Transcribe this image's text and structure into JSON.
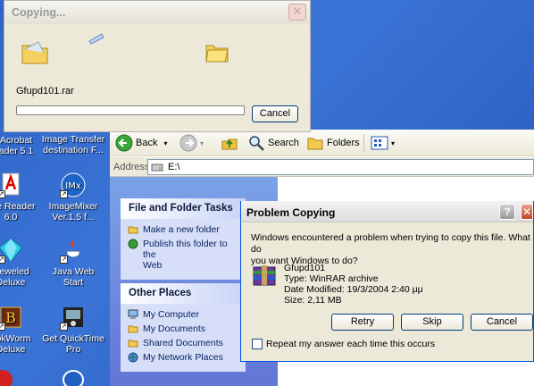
{
  "desktop": {
    "icons": [
      {
        "label_line1": "Acrobat",
        "label_line2": "ader 5.1"
      },
      {
        "label_line1": "Image Transfer",
        "label_line2": "destination F..."
      },
      {
        "label_line1": "obe Reader",
        "label_line2": "6.0"
      },
      {
        "label_line1": "ImageMixer",
        "label_line2": "Ver.1.5 f..."
      },
      {
        "label_line1": "ejeweled",
        "label_line2": "Deluxe"
      },
      {
        "label_line1": "Java Web",
        "label_line2": "Start"
      },
      {
        "label_line1": "ookWorm",
        "label_line2": "Deluxe"
      },
      {
        "label_line1": "Get QuickTime",
        "label_line2": "Pro"
      }
    ]
  },
  "copy_dialog": {
    "title": "Copying...",
    "filename": "Gfupd101.rar",
    "cancel_label": "Cancel",
    "progress": 0
  },
  "explorer": {
    "toolbar": {
      "back_label": "Back",
      "search_label": "Search",
      "folders_label": "Folders"
    },
    "address": {
      "label": "Address",
      "value": "E:\\"
    },
    "file_folder_tasks": {
      "title": "File and Folder Tasks",
      "items": [
        "Make a new folder",
        "Publish this folder to the",
        "Web"
      ]
    },
    "other_places": {
      "title": "Other Places",
      "items": [
        "My Computer",
        "My Documents",
        "Shared Documents",
        "My Network Places"
      ]
    }
  },
  "problem_dialog": {
    "title": "Problem Copying",
    "help_label": "?",
    "message_line1": "Windows encountered a problem when trying to copy this file.  What do",
    "message_line2": "you want Windows to do?",
    "file_name": "Gfupd101",
    "file_type": "Type: WinRAR archive",
    "file_date": "Date Modified: 19/3/2004 2:40 μμ",
    "file_size": "Size: 2,11 MB",
    "retry_label": "Retry",
    "skip_label": "Skip",
    "cancel_label": "Cancel",
    "repeat_label": "Repeat my answer each time this occurs",
    "repeat_checked": false
  },
  "colors": {
    "desktop_bg": "#3a74d6",
    "xp_button_border": "#003c74",
    "task_link": "#0b2364"
  }
}
